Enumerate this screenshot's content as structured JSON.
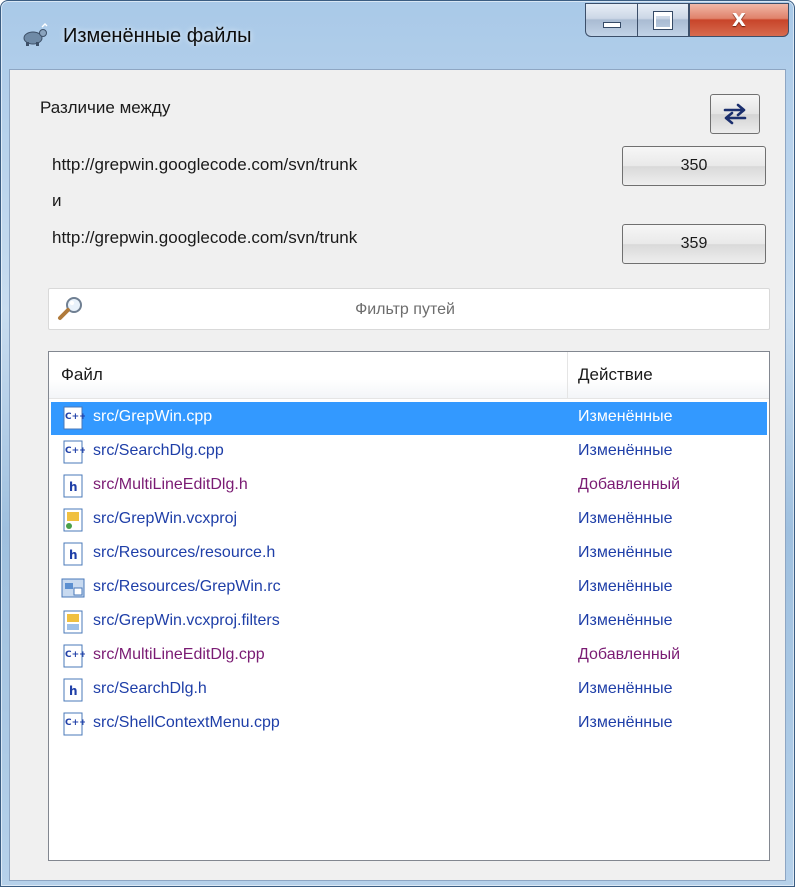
{
  "window": {
    "title": "Изменённые файлы",
    "close_glyph": "X"
  },
  "diff": {
    "label": "Различие между",
    "url1": "http://grepwin.googlecode.com/svn/trunk",
    "and_label": "и",
    "url2": "http://grepwin.googlecode.com/svn/trunk",
    "rev1": "350",
    "rev2": "359"
  },
  "filter": {
    "placeholder": "Фильтр путей",
    "value": ""
  },
  "list": {
    "columns": [
      "Файл",
      "Действие"
    ],
    "rows": [
      {
        "path": "src/GrepWin.cpp",
        "action": "Изменённые",
        "icon": "cpp-file-icon",
        "kind": "mod",
        "selected": true
      },
      {
        "path": "src/SearchDlg.cpp",
        "action": "Изменённые",
        "icon": "cpp-file-icon",
        "kind": "mod",
        "selected": false
      },
      {
        "path": "src/MultiLineEditDlg.h",
        "action": "Добавленный",
        "icon": "header-file-icon",
        "kind": "add",
        "selected": false
      },
      {
        "path": "src/GrepWin.vcxproj",
        "action": "Изменённые",
        "icon": "vcxproj-file-icon",
        "kind": "mod",
        "selected": false
      },
      {
        "path": "src/Resources/resource.h",
        "action": "Изменённые",
        "icon": "header-file-icon",
        "kind": "mod",
        "selected": false
      },
      {
        "path": "src/Resources/GrepWin.rc",
        "action": "Изменённые",
        "icon": "rc-file-icon",
        "kind": "mod",
        "selected": false
      },
      {
        "path": "src/GrepWin.vcxproj.filters",
        "action": "Изменённые",
        "icon": "filters-file-icon",
        "kind": "mod",
        "selected": false
      },
      {
        "path": "src/MultiLineEditDlg.cpp",
        "action": "Добавленный",
        "icon": "cpp-file-icon",
        "kind": "add",
        "selected": false
      },
      {
        "path": "src/SearchDlg.h",
        "action": "Изменённые",
        "icon": "header-file-icon",
        "kind": "mod",
        "selected": false
      },
      {
        "path": "src/ShellContextMenu.cpp",
        "action": "Изменённые",
        "icon": "cpp-file-icon",
        "kind": "mod",
        "selected": false
      }
    ]
  },
  "colors": {
    "modified": "#1f3fa8",
    "added": "#7a1b73",
    "selection": "#3399ff"
  }
}
